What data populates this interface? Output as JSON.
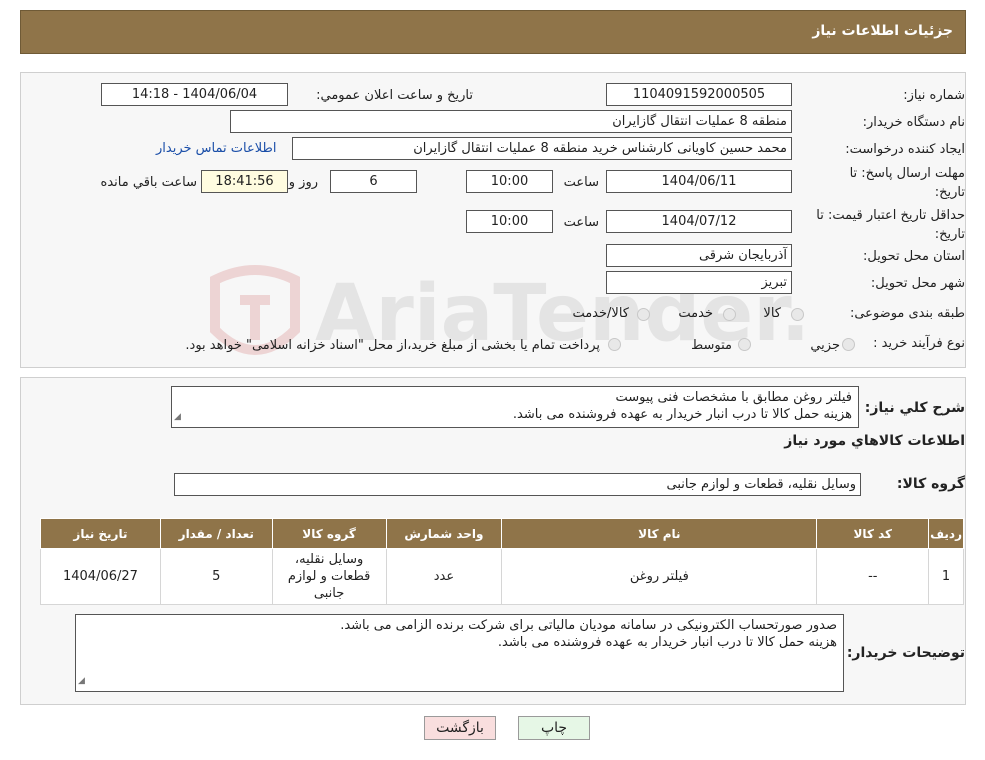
{
  "header": {
    "title": "جزئیات اطلاعات نیاز"
  },
  "form": {
    "need_number_label": "شماره نیاز:",
    "need_number": "1104091592000505",
    "announce_label": "تاریخ و ساعت اعلان عمومي:",
    "announce_value": "1404/06/04 - 14:18",
    "buyer_org_label": "نام دستگاه خريدار:",
    "buyer_org": "منطقه 8 عملیات انتقال گازایران",
    "requester_label": "ايجاد کننده درخواست:",
    "requester": "محمد حسین کاویانی کارشناس خرید منطقه 8 عملیات انتقال گازایران",
    "contact_link": "اطلاعات تماس خريدار",
    "deadline_label": "مهلت ارسال پاسخ: تا تاريخ:",
    "deadline_date": "1404/06/11",
    "hour_label": "ساعت",
    "deadline_time": "10:00",
    "days_value": "6",
    "days_label": "روز و",
    "remaining_time": "18:41:56",
    "remaining_label": "ساعت باقي مانده",
    "validity_label": "حداقل تاريخ اعتبار قيمت: تا تاريخ:",
    "validity_date": "1404/07/12",
    "validity_time": "10:00",
    "province_label": "استان محل تحويل:",
    "province": "آذربایجان شرقی",
    "city_label": "شهر محل تحويل:",
    "city": "تبریز",
    "category_label": "طبقه بندی موضوعی:",
    "category_options": [
      "کالا",
      "خدمت",
      "کالا/خدمت"
    ],
    "process_label": "نوع فرآيند خريد :",
    "process_options": [
      "جزيي",
      "متوسط"
    ],
    "process_note": "پرداخت تمام یا بخشی از مبلغ خرید،از محل \"اسناد خزانه اسلامی\" خواهد بود."
  },
  "description": {
    "label": "شرح کلي نياز:",
    "line1": "فیلتر روغن مطابق با مشخصات فنی پیوست",
    "line2": "هزینه حمل کالا تا درب انبار خریدار به عهده فروشنده می باشد."
  },
  "goods": {
    "section_title": "اطلاعات کالاهاي مورد نياز",
    "group_label": "گروه کالا:",
    "group_value": "وسایل نقلیه، قطعات و لوازم جانبی",
    "table": {
      "headers": [
        "رديف",
        "کد کالا",
        "نام کالا",
        "واحد شمارش",
        "گروه کالا",
        "تعداد / مقدار",
        "تاريخ نياز"
      ],
      "rows": [
        [
          "1",
          "--",
          "فیلتر روغن",
          "عدد",
          "وسایل نقلیه، قطعات و لوازم جانبی",
          "5",
          "1404/06/27"
        ]
      ]
    }
  },
  "buyer_notes": {
    "label": "توضيحات خريدار:",
    "line1": "صدور صورتحساب الکترونیکی در سامانه مودیان مالیاتی برای شرکت برنده الزامی می باشد.",
    "line2": "هزینه حمل کالا تا درب انبار خریدار به عهده فروشنده می باشد."
  },
  "buttons": {
    "print": "چاپ",
    "back": "بازگشت"
  },
  "watermark": {
    "text": "AriaTender.neT"
  },
  "colors": {
    "header_bg": "#8f7449",
    "link": "#1a4ea8",
    "remaining_bg": "#fffce0",
    "back_btn_bg": "#f9dede",
    "print_btn_bg": "#e6f7e6"
  }
}
